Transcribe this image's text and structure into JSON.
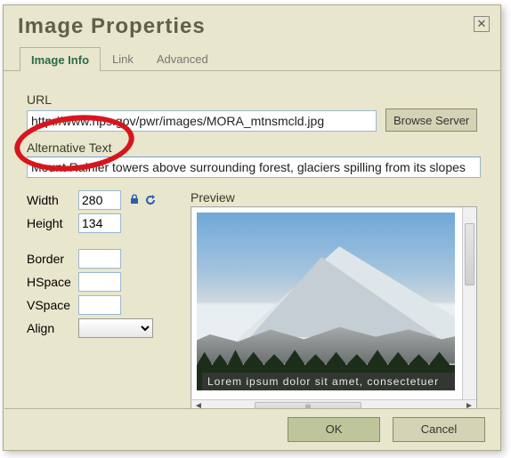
{
  "dialog": {
    "title": "Image Properties"
  },
  "tabs": {
    "info": "Image Info",
    "link": "Link",
    "advanced": "Advanced"
  },
  "fields": {
    "url_label": "URL",
    "url_value": "http://www.nps.gov/pwr/images/MORA_mtnsmcld.jpg",
    "browse_label": "Browse Server",
    "alt_label": "Alternative Text",
    "alt_value": "Mount Rainier towers above surrounding forest, glaciers spilling from its slopes",
    "width_label": "Width",
    "width_value": "280",
    "height_label": "Height",
    "height_value": "134",
    "border_label": "Border",
    "border_value": "",
    "hspace_label": "HSpace",
    "hspace_value": "",
    "vspace_label": "VSpace",
    "vspace_value": "",
    "align_label": "Align",
    "align_value": ""
  },
  "preview": {
    "label": "Preview",
    "caption": "Lorem ipsum dolor sit amet, consectetuer"
  },
  "buttons": {
    "ok": "OK",
    "cancel": "Cancel"
  }
}
